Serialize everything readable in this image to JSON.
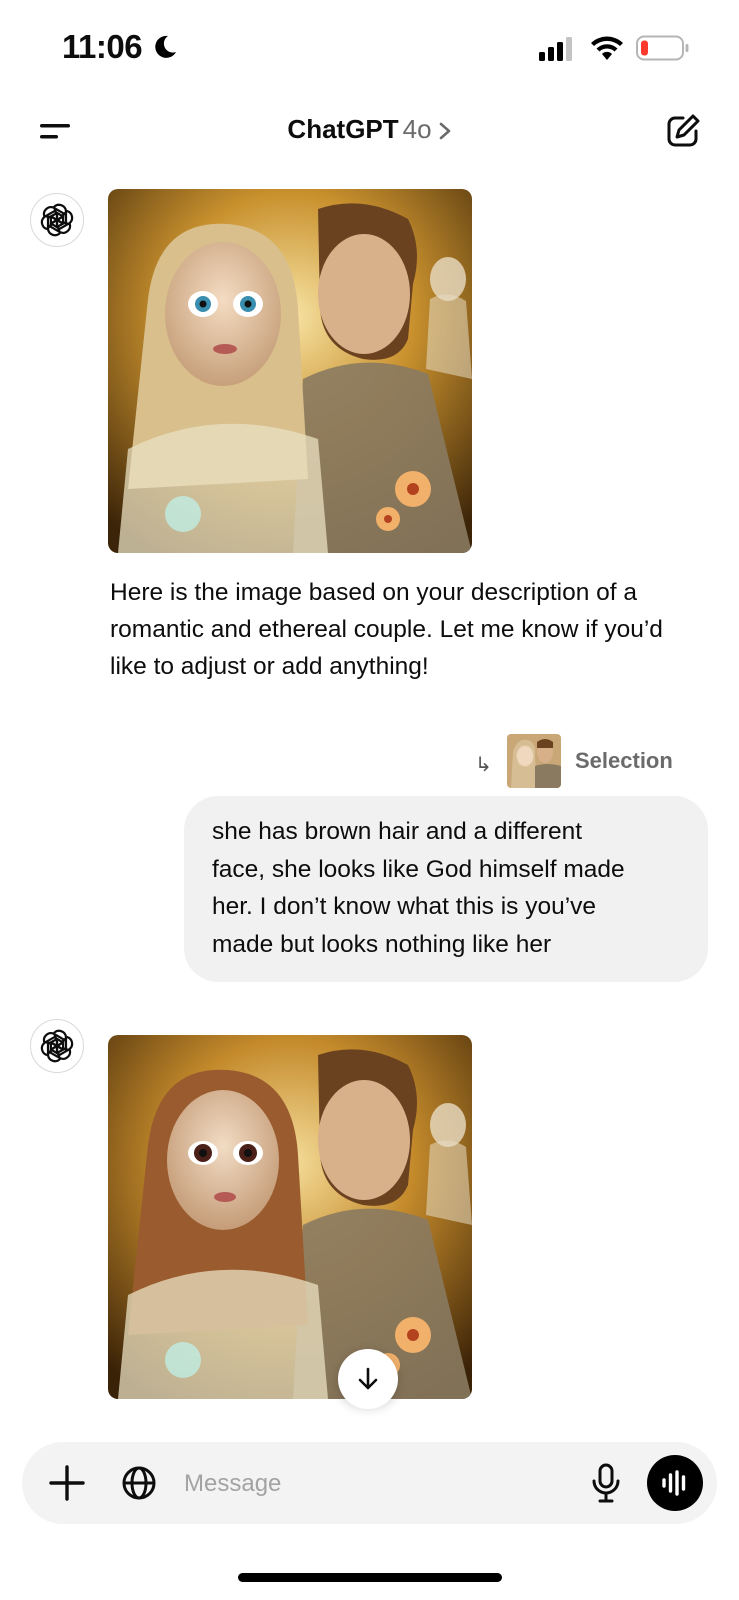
{
  "status_bar": {
    "time": "11:06",
    "moon_icon": "moon-icon",
    "signal_icon": "cellular-signal-icon",
    "wifi_icon": "wifi-icon",
    "battery_icon": "battery-low-icon",
    "battery_color": "#ff3b30"
  },
  "header": {
    "title": "ChatGPT",
    "model": "4o",
    "menu_icon": "menu-icon",
    "chevron_icon": "chevron-right-icon",
    "new_chat_icon": "new-chat-icon"
  },
  "messages": [
    {
      "role": "assistant",
      "avatar_icon": "openai-logo-icon",
      "image": "generated-image-couple-1",
      "text": "Here is the image based on your description of a romantic and ethereal couple. Let me know if you’d like to adjust or add anything!"
    },
    {
      "role": "user",
      "selection": {
        "arrow_icon": "reply-arrow-icon",
        "label": "Selection"
      },
      "lines": [
        "she has brown hair and a different",
        "face, she looks like God himself made",
        "her. I don’t know what this is you’ve",
        "made but looks nothing like her"
      ]
    },
    {
      "role": "assistant",
      "avatar_icon": "openai-logo-icon",
      "image": "generated-image-couple-2"
    }
  ],
  "scroll_down_icon": "arrow-down-icon",
  "composer": {
    "placeholder": "Message",
    "plus_icon": "plus-icon",
    "globe_icon": "globe-icon",
    "mic_icon": "microphone-icon",
    "voice_icon": "voice-mode-icon"
  }
}
